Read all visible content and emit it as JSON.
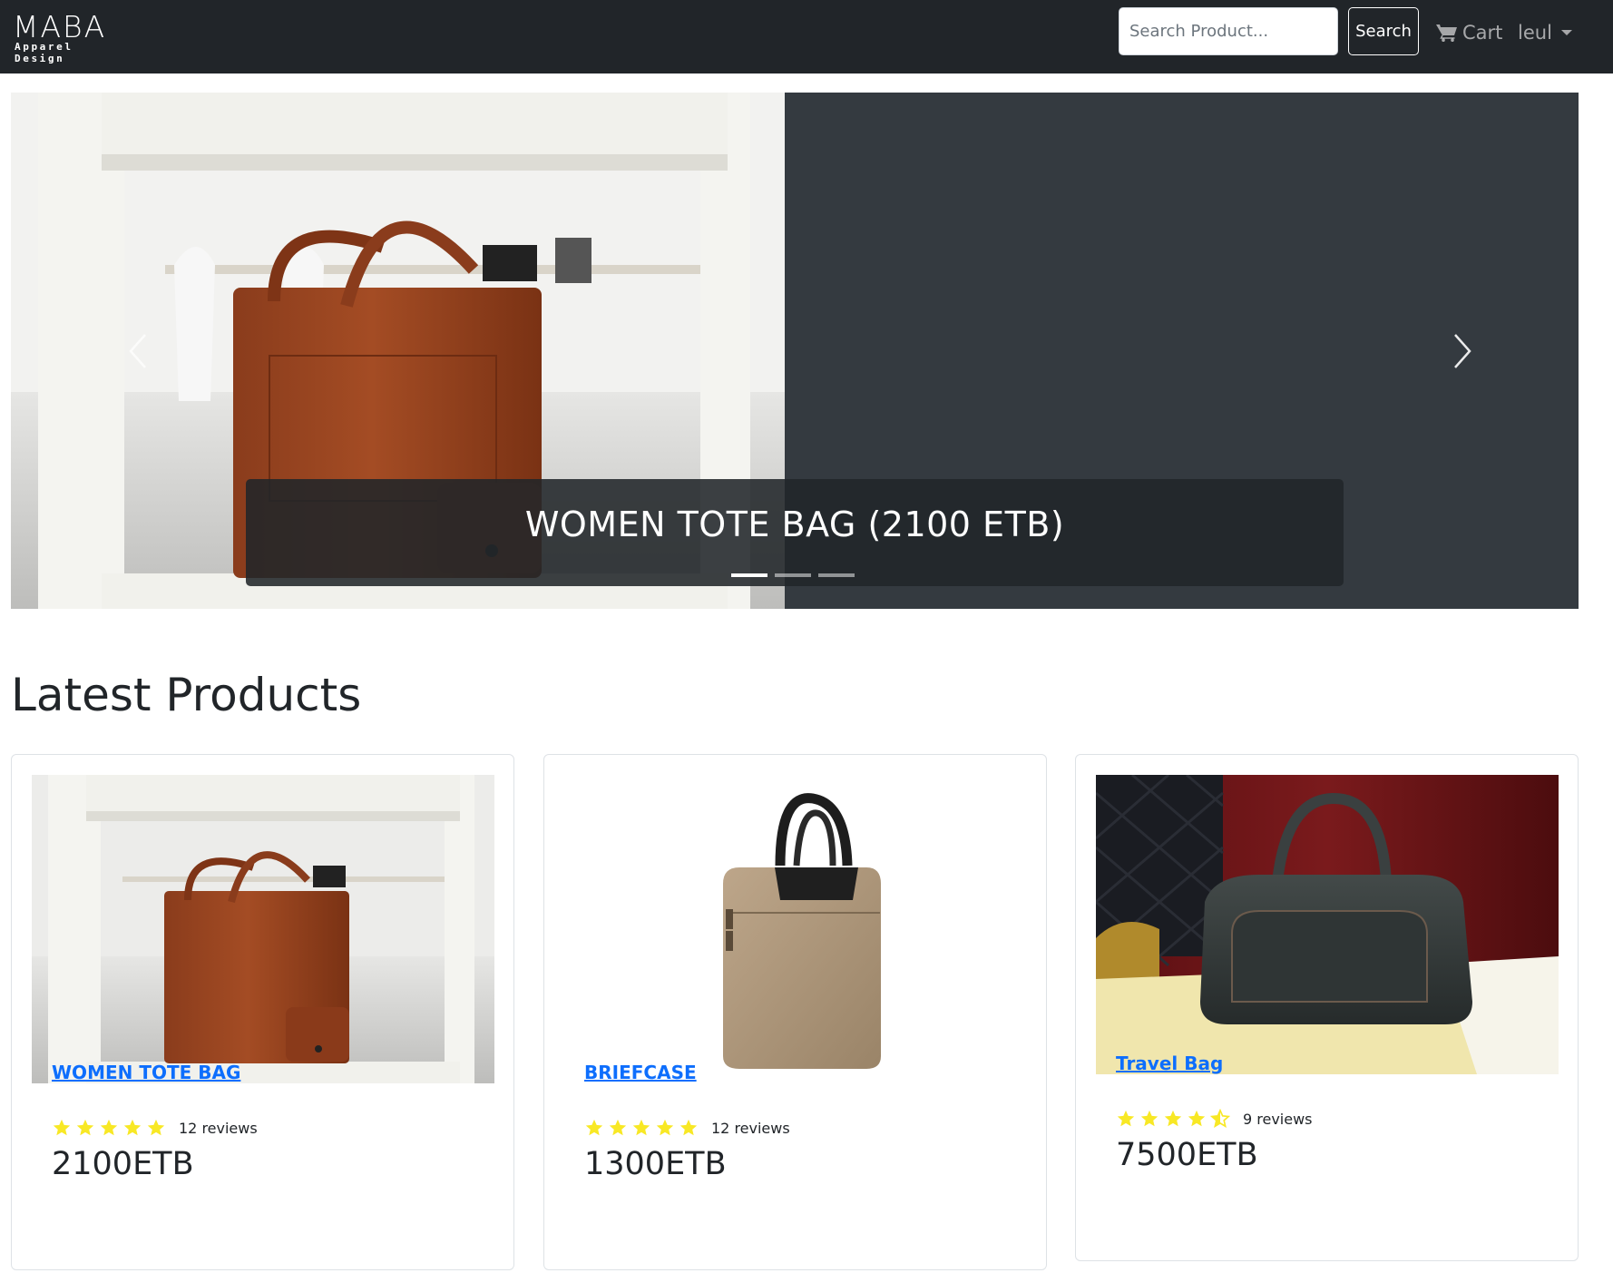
{
  "brand": {
    "name": "MABA",
    "tagline": "Apparel Design"
  },
  "navbar": {
    "search_placeholder": "Search Product...",
    "search_button": "Search",
    "cart_label": "Cart",
    "user_label": "leul",
    "icons": {
      "cart": "cart-icon",
      "dropdown": "caret-down-icon"
    }
  },
  "carousel": {
    "caption": "WOMEN TOTE BAG (2100 ETB)",
    "slide_count": 3,
    "active_slide": 0,
    "icons": {
      "prev": "chevron-left-icon",
      "next": "chevron-right-icon"
    }
  },
  "section": {
    "title": "Latest Products"
  },
  "products": [
    {
      "name": "WOMEN TOTE BAG",
      "rating": 5,
      "reviews": "12 reviews",
      "price": "2100ETB"
    },
    {
      "name": "BRIEFCASE",
      "rating": 5,
      "reviews": "12 reviews",
      "price": "1300ETB"
    },
    {
      "name": "Travel Bag",
      "rating": 4.5,
      "reviews": "9 reviews",
      "price": "7500ETB"
    }
  ],
  "colors": {
    "navbar_bg": "#212529",
    "carousel_bg": "#343a40",
    "link": "#0d6efd",
    "star": "#f8e825"
  }
}
